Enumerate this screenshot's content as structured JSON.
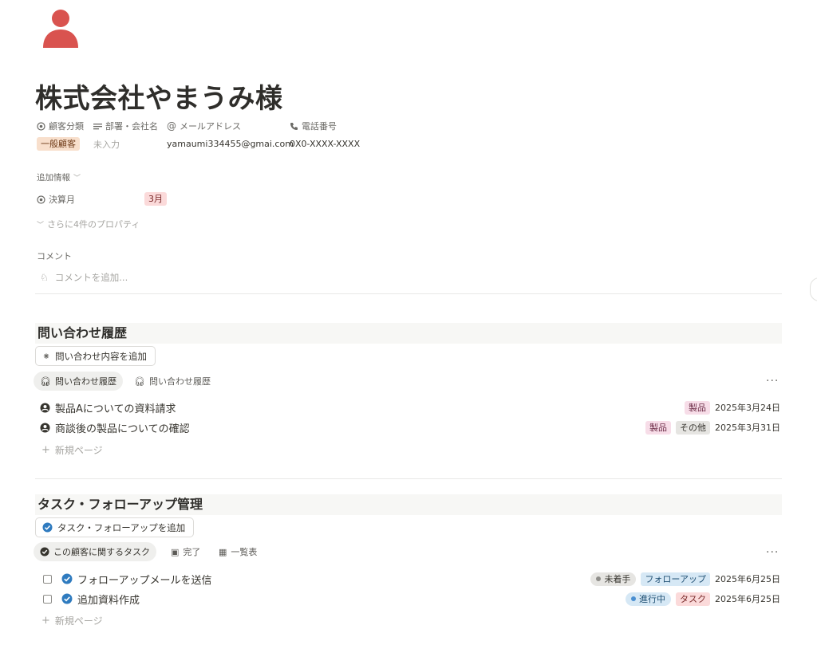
{
  "page": {
    "title": "株式会社やまうみ様",
    "icon": "person-icon",
    "accent_color": "#d9534f"
  },
  "properties": [
    {
      "label": "顧客分類",
      "icon": "select-icon",
      "value": "一般顧客",
      "kind": "tag-orange"
    },
    {
      "label": "部署・会社名",
      "icon": "text-lines-icon",
      "value": "未入力",
      "kind": "empty"
    },
    {
      "label": "メールアドレス",
      "icon": "at-icon",
      "value": "yamaumi334455@gmai.com",
      "kind": "text"
    },
    {
      "label": "電話番号",
      "icon": "phone-icon",
      "value": "0X0-XXXX-XXXX",
      "kind": "text"
    }
  ],
  "additional": {
    "header": "追加情報",
    "fiscal_month_label": "決算月",
    "fiscal_month_value": "3月",
    "more_props": "さらに4件のプロパティ"
  },
  "comments": {
    "header": "コメント",
    "placeholder": "コメントを追加..."
  },
  "inquiries": {
    "title": "問い合わせ履歴",
    "add_button": "問い合わせ内容を追加",
    "tabs": [
      "問い合わせ履歴",
      "問い合わせ履歴"
    ],
    "more": "···",
    "rows": [
      {
        "title": "製品Aについての資料請求",
        "tags": [
          {
            "label": "製品",
            "kind": "tag-pink"
          }
        ],
        "date": "2025年3月24日"
      },
      {
        "title": "商談後の製品についての確認",
        "tags": [
          {
            "label": "製品",
            "kind": "tag-pink"
          },
          {
            "label": "その他",
            "kind": "tag-gray"
          }
        ],
        "date": "2025年3月31日"
      }
    ],
    "new_page": "新規ページ"
  },
  "tasks": {
    "title": "タスク・フォローアップ管理",
    "add_button": "タスク・フォローアップを追加",
    "tabs": [
      "この顧客に関するタスク",
      "完了",
      "一覧表"
    ],
    "more": "···",
    "rows": [
      {
        "title": "フォローアップメールを送信",
        "status": {
          "label": "未着手",
          "dot": "#8f8e8a",
          "kind": "tag-gray"
        },
        "type": {
          "label": "フォローアップ",
          "kind": "tag-blue"
        },
        "date": "2025年6月25日"
      },
      {
        "title": "追加資料作成",
        "status": {
          "label": "進行中",
          "dot": "#4a8fd1",
          "kind": "tag-blue"
        },
        "type": {
          "label": "タスク",
          "kind": "tag-red"
        },
        "date": "2025年6月25日"
      }
    ],
    "new_page": "新規ページ"
  }
}
